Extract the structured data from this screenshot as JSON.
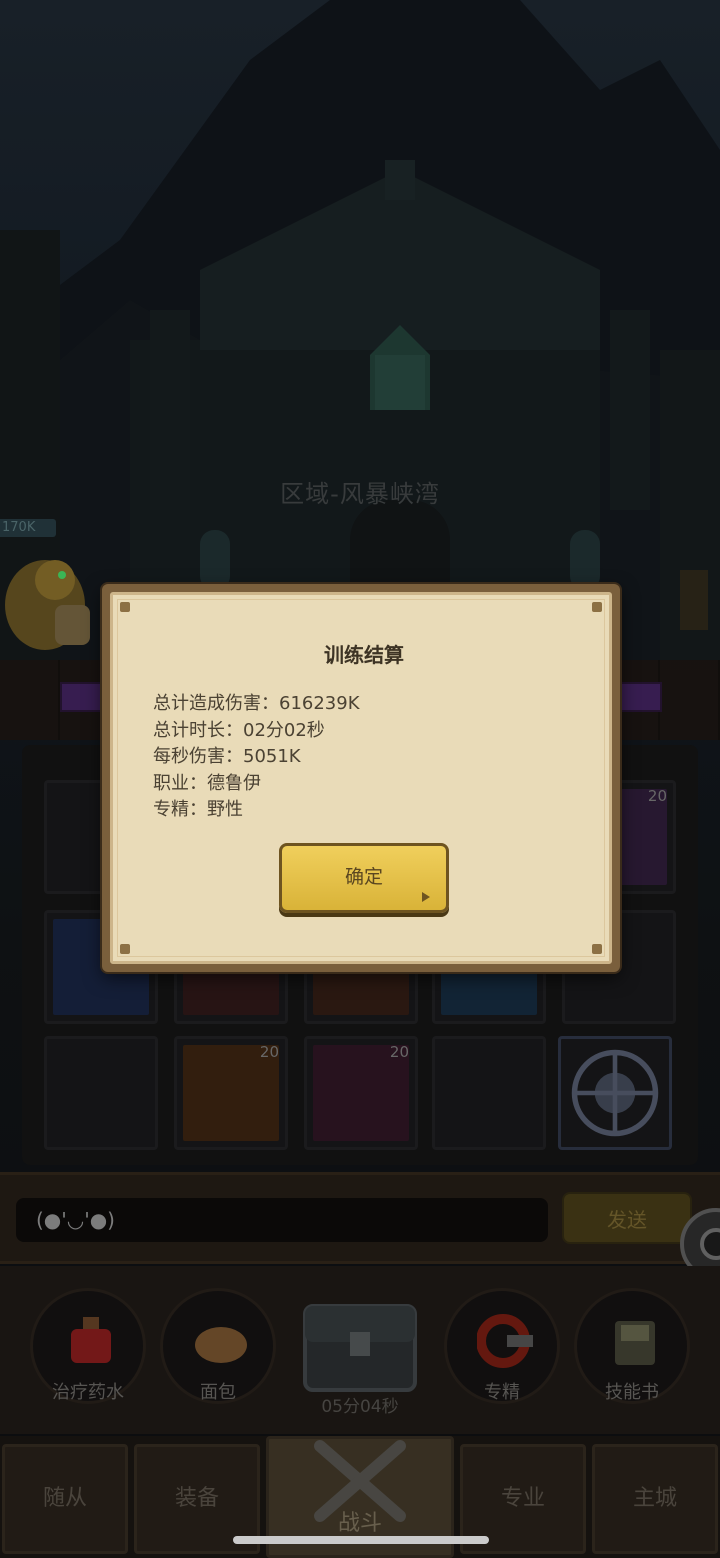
{
  "scene": {
    "zone_name": "区域-风暴峡湾",
    "hero_hp": "170K"
  },
  "dialog": {
    "title": "训练结算",
    "stats": [
      "总计造成伤害：616239K",
      "总计时长：02分02秒",
      "每秒伤害：5051K",
      "职业：德鲁伊",
      "专精：野性"
    ],
    "confirm_label": "确定"
  },
  "skill_slots": {
    "counts": [
      "20",
      "20",
      "20"
    ]
  },
  "chat": {
    "input_value": "(●'◡'●)",
    "send_label": "发送"
  },
  "actions": {
    "items": [
      {
        "label": "治疗药水",
        "icon": "potion-icon"
      },
      {
        "label": "面包",
        "icon": "bread-icon"
      },
      {
        "label": "专精",
        "icon": "spec-icon"
      },
      {
        "label": "技能书",
        "icon": "skillbook-icon"
      }
    ],
    "chest_timer": "05分04秒"
  },
  "nav": {
    "tabs": [
      "随从",
      "装备",
      "战斗",
      "专业",
      "主城"
    ],
    "active": "战斗"
  },
  "colors": {
    "dialog_bg": "#e9dbb8",
    "button_gold": "#e3bf48"
  }
}
